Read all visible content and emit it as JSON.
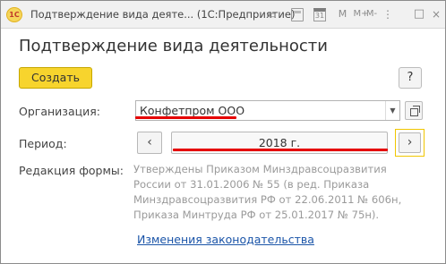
{
  "window": {
    "logo_text": "1С",
    "title": "Подтверждение вида деяте...  (1С:Предприятие)",
    "controls": [
      "M",
      "M+",
      "M-",
      "⋮",
      "□",
      "×"
    ]
  },
  "form": {
    "title": "Подтверждение вида деятельности",
    "create_label": "Создать",
    "help_label": "?"
  },
  "organization": {
    "label": "Организация:",
    "value": "Конфетпром ООО"
  },
  "period": {
    "label": "Период:",
    "prev": "‹",
    "value": "2018 г.",
    "next": "›"
  },
  "form_edition": {
    "label": "Редакция формы:",
    "lines": [
      "Утверждены Приказом Минздравсоцразвития",
      "России от 31.01.2006 № 55 (в ред. Приказа",
      "Минздравсоцразвития РФ от 22.06.2011 № 606н,",
      "Приказа Минтруда РФ от 25.01.2017 № 75н)."
    ]
  },
  "link": {
    "label": "Изменения законодательства"
  },
  "colors": {
    "accent": "#f7d42d",
    "link": "#1a54a8",
    "highlight_underline": "#e50000",
    "focus_border": "#f0c600"
  }
}
